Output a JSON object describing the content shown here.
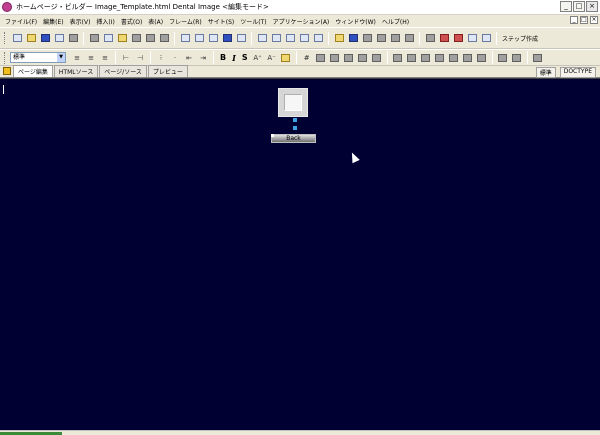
{
  "window": {
    "title": "ホームページ・ビルダー  Image_Template.html  Dental Image <編集モード>",
    "buttons": [
      "_",
      "□",
      "×"
    ]
  },
  "menu": [
    "ファイル(F)",
    "編集(E)",
    "表示(V)",
    "挿入(I)",
    "書式(O)",
    "表(A)",
    "フレーム(R)",
    "サイト(S)",
    "ツール(T)",
    "アプリケーション(A)",
    "ウィンドウ(W)",
    "ヘルプ(H)"
  ],
  "doc_controls": [
    "_",
    "□",
    "×"
  ],
  "toolbar1": {
    "label": "ステップ作成"
  },
  "toolbar2": {
    "style_select": "標準",
    "bold": "B",
    "italic": "I",
    "strike": "S"
  },
  "tabs": [
    "ページ編集",
    "HTMLソース",
    "ページ/ソース",
    "プレビュー"
  ],
  "tab_right": [
    "標準",
    "DOCTYPE"
  ],
  "editor": {
    "button_label": "Back"
  },
  "colors": {
    "editor_bg": "#000033",
    "chrome": "#ece9d8"
  }
}
